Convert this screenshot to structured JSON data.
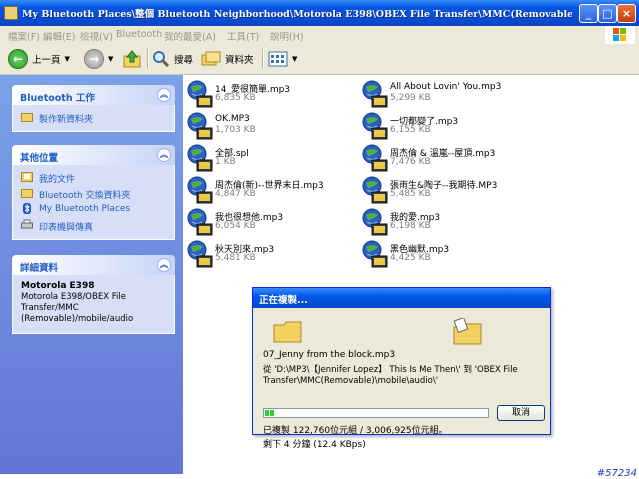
{
  "window": {
    "title": "My Bluetooth Places\\整個 Bluetooth Neighborhood\\Motorola E398\\OBEX File Transfer\\MMC(Removable)\\m",
    "minimize": "_",
    "maximize": "□",
    "close": "×"
  },
  "menubar": [
    "檔案(F)",
    "編輯(E)",
    "檢視(V)",
    "Bluetooth",
    "我的最愛(A)",
    "工具(T)",
    "說明(H)"
  ],
  "toolbar": {
    "back_label": "上一頁",
    "search_label": "搜尋",
    "folders_label": "資料夾"
  },
  "sidebar": {
    "tasks": {
      "title": "Bluetooth 工作",
      "items": [
        "製作新資料夾"
      ]
    },
    "other_places": {
      "title": "其他位置",
      "items": [
        "我的文件",
        "Bluetooth 交換資料夾",
        "My Bluetooth Places",
        "印表機與傳真"
      ]
    },
    "details": {
      "title": "詳細資料",
      "name": "Motorola E398",
      "path": "Motorola E398/OBEX File Transfer/MMC (Removable)/mobile/audio"
    }
  },
  "files": [
    {
      "name": "14_愛很簡單.mp3",
      "size": "6,835 KB"
    },
    {
      "name": "All About Lovin' You.mp3",
      "size": "5,299 KB"
    },
    {
      "name": "OK.MP3",
      "size": "1,703 KB"
    },
    {
      "name": "一切都變了.mp3",
      "size": "6,155 KB"
    },
    {
      "name": "全部.spl",
      "size": "1 KB"
    },
    {
      "name": "周杰倫 & 溫嵐--屋頂.mp3",
      "size": "7,476 KB"
    },
    {
      "name": "周杰倫(新)--世界末日.mp3",
      "size": "4,847 KB"
    },
    {
      "name": "張雨生&陶子--我期待.MP3",
      "size": "5,485 KB"
    },
    {
      "name": "我也很想他.mp3",
      "size": "6,054 KB"
    },
    {
      "name": "我的愛.mp3",
      "size": "6,198 KB"
    },
    {
      "name": "秋天別來.mp3",
      "size": "5,481 KB"
    },
    {
      "name": "黑色幽默.mp3",
      "size": "4,425 KB"
    }
  ],
  "copy_dialog": {
    "title": "正在複製...",
    "filename": "07_Jenny from the block.mp3",
    "from_to": "從 'D:\\MP3\\【Jennifer Lopez】 This Is Me Then\\' 到 'OBEX File Transfer\\MMC(Removable)\\mobile\\audio\\'",
    "progress_fraction": 0.04,
    "copied": "已複製 122,760位元組 / 3,006,925位元組。",
    "remaining": "剩下 4 分鐘 (12.4 KBps)",
    "cancel_label": "取消"
  },
  "stamp": "#57234"
}
